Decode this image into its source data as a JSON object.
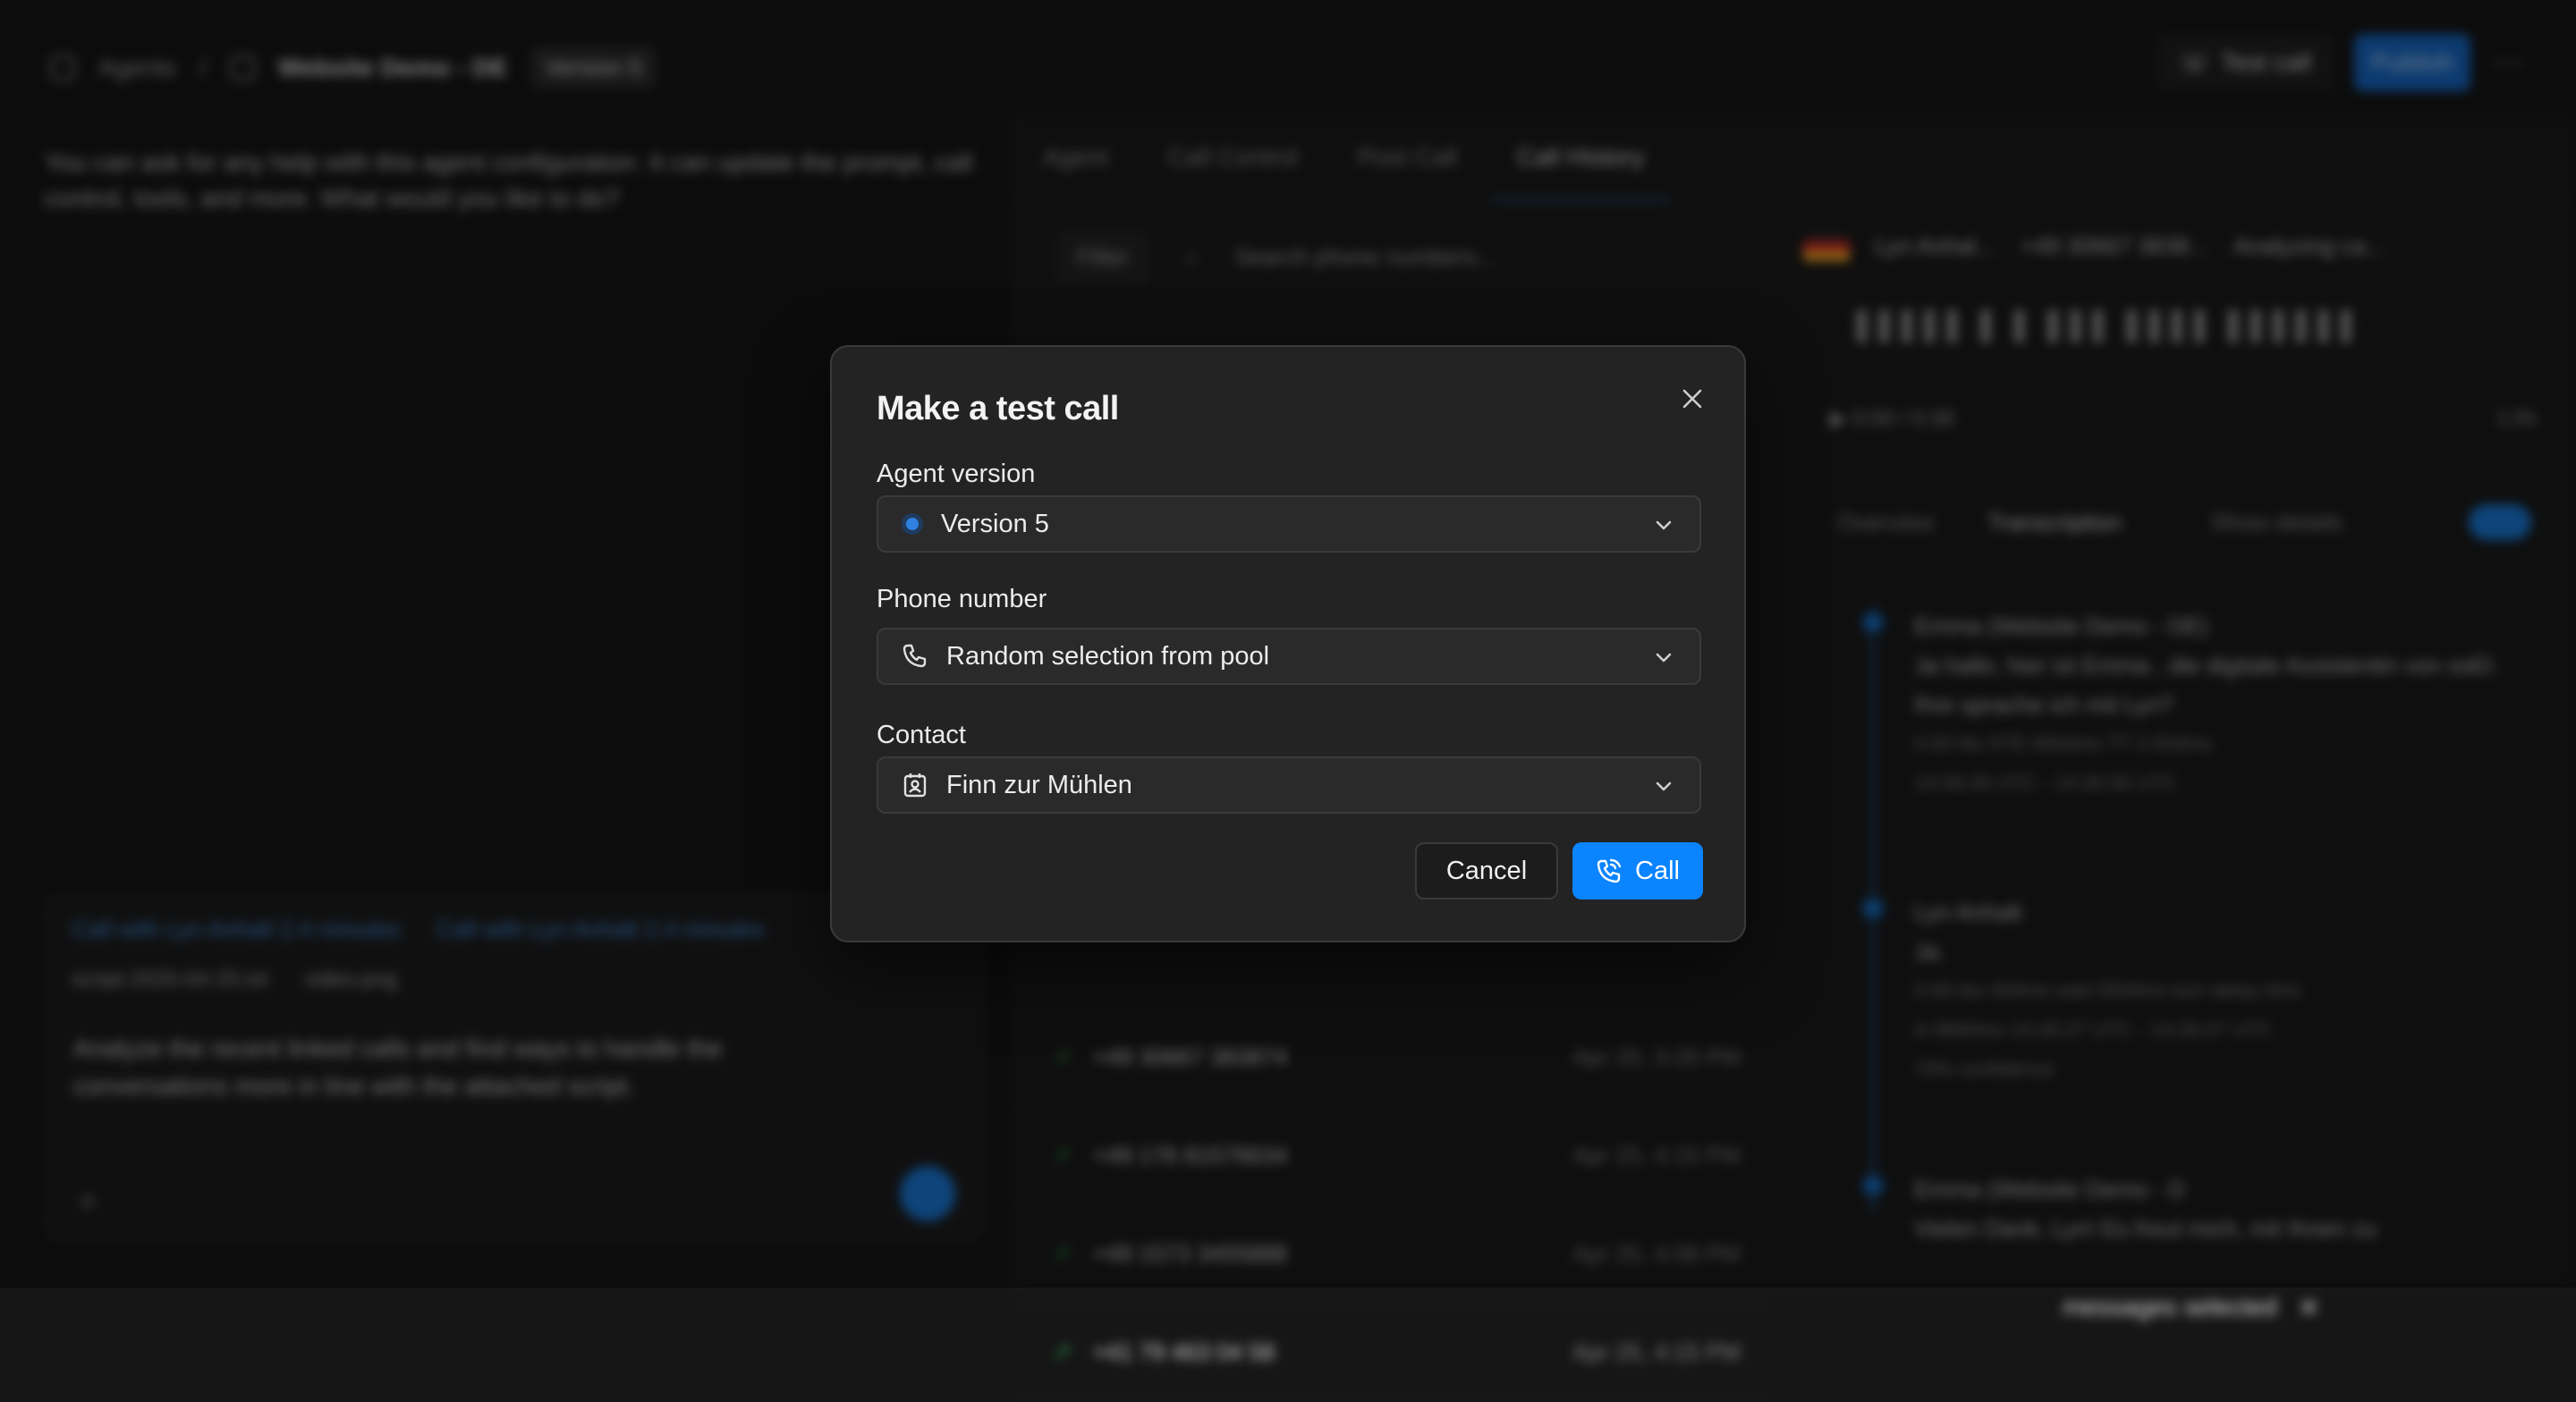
{
  "topbar": {
    "breadcrumb_root": "Agents",
    "agent_name": "Website Demo - DE",
    "version_chip": "Version 5",
    "test_call_label": "Test call",
    "publish_label": "Publish"
  },
  "assistant": {
    "intro": "You can ask for any help with this agent configuration. It can update the prompt, call control, tools, and more. What would you like to do?",
    "context_chips": [
      "Call with Lyn Anhalt 2.4 minutes",
      "Call with Lyn Anhalt 2.4 minutes"
    ],
    "attachments": [
      "script-2025-04-25.txt",
      "video.png"
    ],
    "draft": "Analyze the recent linked calls and find ways to handle the conversations more in line with the attached script."
  },
  "right_tabs": [
    "Agent",
    "Call Control",
    "Post Call",
    "Call History"
  ],
  "filters": {
    "filter_label": "Filter",
    "search_placeholder": "Search phone numbers..."
  },
  "call_list": [
    {
      "number": "+49 30667 383874",
      "date": "Apr 25, 3:26 PM"
    },
    {
      "number": "+49 176 81576634",
      "date": "Apr 25, 4:15 PM"
    },
    {
      "number": "+49 1573 3455888",
      "date": "Apr 25, 4:08 PM"
    },
    {
      "number": "+41 79 463 04 58",
      "date": "Apr 25, 4:15 PM"
    }
  ],
  "detail": {
    "caller": "Lyn Anhal...",
    "phone": "+49 30667 3838...",
    "status": "Analyzing ca...",
    "time": "0:00 / 0:38",
    "speed": "1.0x",
    "sub_tabs": [
      "Overview",
      "Transcription"
    ],
    "show_details": "Show details",
    "transcript": [
      {
        "speaker": "Emma (Website Demo - DE)",
        "text": "Ja hallo, hier ist Emma , die digitale Assistentin von ssEl. Ihre sprache ich mit Lyn?",
        "meta1": "0.00   No STE 6004ms   TT 2.554ms",
        "meta2": "14:26:26 UTC - 14:26:26 UTC"
      },
      {
        "speaker": "Lyn Anhalt",
        "text": "Ja.",
        "meta1": "0.00   dur 834ms   wait 5834ms   turn delay 0ms",
        "meta2": "in 8684ms   14:26:27 UTC - 14:26:27 UTC",
        "meta3": "70% confidence"
      },
      {
        "speaker": "Emma (Website Demo - D",
        "text": "Vielen Dank, Lyn! Es freut mich, mit Ihnen zu"
      }
    ],
    "selection_label": "messages selected"
  },
  "modal": {
    "title": "Make a test call",
    "agent_version_label": "Agent version",
    "agent_version_value": "Version 5",
    "phone_number_label": "Phone number",
    "phone_number_value": "Random selection from pool",
    "contact_label": "Contact",
    "contact_value": "Finn zur Mühlen",
    "cancel_label": "Cancel",
    "call_label": "Call"
  },
  "colors": {
    "accent": "#0a84ff",
    "modal_bg": "#232323",
    "page_bg": "#161616"
  }
}
